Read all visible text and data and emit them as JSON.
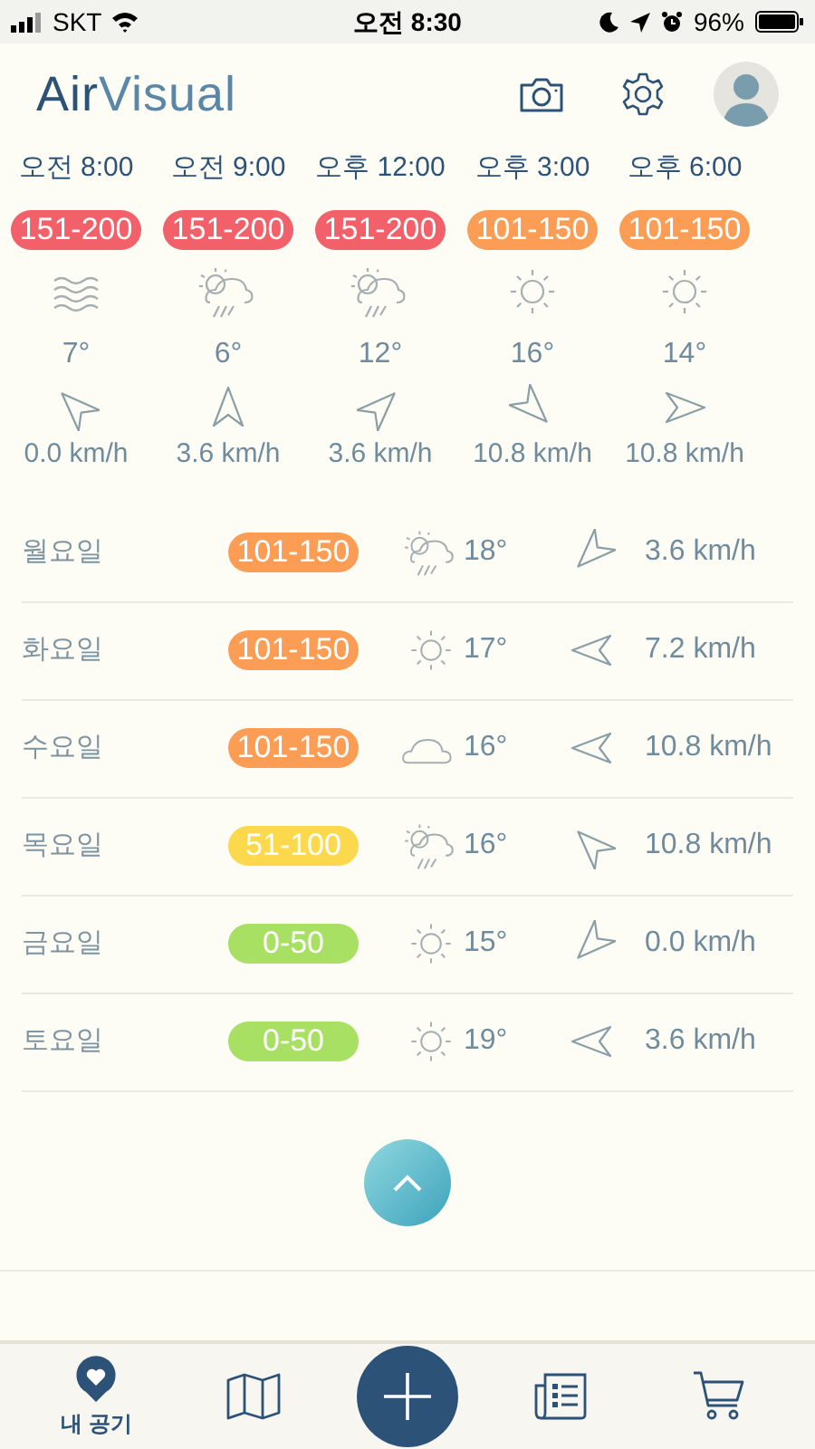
{
  "status_bar": {
    "carrier": "SKT",
    "time": "오전 8:30",
    "battery": "96%"
  },
  "header": {
    "logo_parts": [
      "Air",
      "Visual"
    ]
  },
  "hourly": [
    {
      "time": "오전 8:00",
      "aqi": "151-200",
      "color": "#f2616a",
      "weather": {
        "kind": "wind"
      },
      "temp": "7°",
      "wind_arrow": {
        "kind": "nw"
      },
      "wind": "0.0 km/h"
    },
    {
      "time": "오전 9:00",
      "aqi": "151-200",
      "color": "#f2616a",
      "weather": {
        "kind": "rain"
      },
      "temp": "6°",
      "wind_arrow": {
        "kind": "n"
      },
      "wind": "3.6 km/h"
    },
    {
      "time": "오후 12:00",
      "aqi": "151-200",
      "color": "#f2616a",
      "weather": {
        "kind": "rain"
      },
      "temp": "12°",
      "wind_arrow": {
        "kind": "ne"
      },
      "wind": "3.6 km/h"
    },
    {
      "time": "오후 3:00",
      "aqi": "101-150",
      "color": "#fb9d55",
      "weather": {
        "kind": "sun"
      },
      "temp": "16°",
      "wind_arrow": {
        "kind": "se"
      },
      "wind": "10.8 km/h"
    },
    {
      "time": "오후 6:00",
      "aqi": "101-150",
      "color": "#fb9d55",
      "weather": {
        "kind": "sun"
      },
      "temp": "14°",
      "wind_arrow": {
        "kind": "e"
      },
      "wind": "10.8 km/h"
    }
  ],
  "daily": [
    {
      "day": "월요일",
      "aqi": "101-150",
      "color": "#fb9d55",
      "weather": {
        "kind": "rain"
      },
      "temp": "18°",
      "wind_arrow": {
        "kind": "sw"
      },
      "wind": "3.6 km/h"
    },
    {
      "day": "화요일",
      "aqi": "101-150",
      "color": "#fb9d55",
      "weather": {
        "kind": "sun"
      },
      "temp": "17°",
      "wind_arrow": {
        "kind": "w"
      },
      "wind": "7.2 km/h"
    },
    {
      "day": "수요일",
      "aqi": "101-150",
      "color": "#fb9d55",
      "weather": {
        "kind": "cloud"
      },
      "temp": "16°",
      "wind_arrow": {
        "kind": "w"
      },
      "wind": "10.8 km/h"
    },
    {
      "day": "목요일",
      "aqi": "51-100",
      "color": "#fcd94c",
      "weather": {
        "kind": "rain"
      },
      "temp": "16°",
      "wind_arrow": {
        "kind": "nw"
      },
      "wind": "10.8 km/h"
    },
    {
      "day": "금요일",
      "aqi": "0-50",
      "color": "#a8e063",
      "weather": {
        "kind": "sun"
      },
      "temp": "15°",
      "wind_arrow": {
        "kind": "sw"
      },
      "wind": "0.0 km/h"
    },
    {
      "day": "토요일",
      "aqi": "0-50",
      "color": "#a8e063",
      "weather": {
        "kind": "sun"
      },
      "temp": "19°",
      "wind_arrow": {
        "kind": "w"
      },
      "wind": "3.6 km/h"
    }
  ],
  "nav": [
    {
      "kind": "air",
      "label": "내 공기",
      "selected": true
    },
    {
      "kind": "map",
      "selected": false
    },
    {
      "kind": "add",
      "selected": false
    },
    {
      "kind": "news",
      "selected": false
    },
    {
      "kind": "shop",
      "selected": false
    }
  ]
}
